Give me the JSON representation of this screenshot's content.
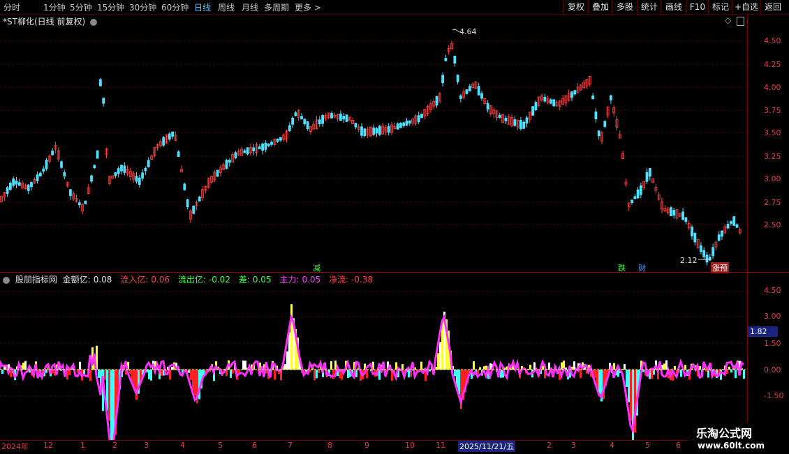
{
  "toolbar": {
    "periods": [
      "分时",
      "1分钟",
      "5分钟",
      "15分钟",
      "30分钟",
      "60分钟",
      "日线",
      "周线",
      "月线",
      "多周期",
      "更多 >"
    ],
    "active_period": "日线",
    "buttons": [
      "复权",
      "叠加",
      "多股",
      "统计",
      "画线",
      "F10",
      "标记",
      "+自选",
      "返回"
    ]
  },
  "main": {
    "title": "*ST柳化(日线 前复权)",
    "yticks": [
      "4.50",
      "4.25",
      "4.00",
      "3.75",
      "3.50",
      "3.25",
      "3.00",
      "2.75",
      "2.50"
    ],
    "high_label": "4.64",
    "low_label": "2.12",
    "markers": [
      "减",
      "跌",
      "财",
      "涨预"
    ]
  },
  "indicator": {
    "name": "股朋指标网",
    "items": [
      {
        "label": "金额亿:",
        "value": "0.08",
        "color": "#e0e0e0"
      },
      {
        "label": "流入亿:",
        "value": "0.06",
        "color": "#ff4040"
      },
      {
        "label": "流出亿:",
        "value": "-0.02",
        "color": "#40ff40"
      },
      {
        "label": "差:",
        "value": "0.05",
        "color": "#40ff40"
      },
      {
        "label": "主力:",
        "value": "0.05",
        "color": "#ff40ff"
      },
      {
        "label": "净流:",
        "value": "-0.38",
        "color": "#ff4040"
      }
    ],
    "yticks": [
      "4.50",
      "3.00",
      "1.50",
      "0.00",
      "-1.50"
    ],
    "current_value": "1.82"
  },
  "xaxis": {
    "labels": [
      "2024年",
      "12",
      "1",
      "2",
      "3",
      "4",
      "5",
      "6",
      "7",
      "8",
      "9",
      "10",
      "11",
      "2025/11/21/五",
      "2",
      "3",
      "4",
      "5",
      "6"
    ]
  },
  "watermark": {
    "title": "乐淘公式网",
    "url": "www.60lt.com"
  },
  "colors": {
    "up": "#ff4040",
    "down": "#4fe0ff",
    "grid": "#5a0000",
    "accent": "#4fc3ff"
  }
}
